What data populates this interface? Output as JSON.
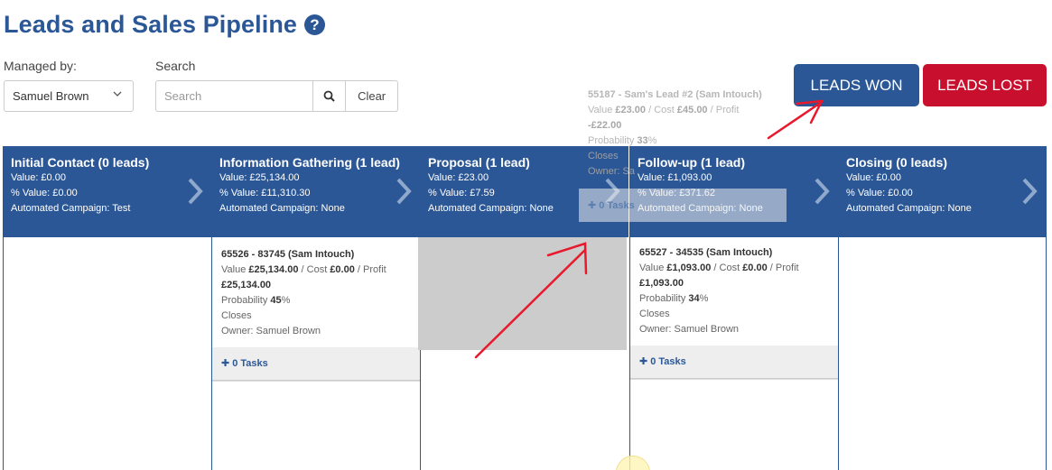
{
  "page": {
    "title": "Leads and Sales Pipeline",
    "help_icon": "question-circle-icon"
  },
  "filters": {
    "managed_label": "Managed by:",
    "managed_value": "Samuel Brown",
    "search_label": "Search",
    "search_placeholder": "Search",
    "clear_label": "Clear"
  },
  "actions": {
    "won_label": "LEADS WON",
    "lost_label": "LEADS LOST",
    "won_color": "#2b5797",
    "lost_color": "#c8102e"
  },
  "columns": [
    {
      "title": "Initial Contact (0 leads)",
      "value": "Value: £0.00",
      "pct_value": "% Value: £0.00",
      "campaign": "Automated Campaign: Test"
    },
    {
      "title": "Information Gathering (1 lead)",
      "value": "Value: £25,134.00",
      "pct_value": "% Value: £11,310.30",
      "campaign": "Automated Campaign: None"
    },
    {
      "title": "Proposal (1 lead)",
      "value": "Value: £23.00",
      "pct_value": "% Value: £7.59",
      "campaign": "Automated Campaign: None"
    },
    {
      "title": "Follow-up (1 lead)",
      "value": "Value: £1,093.00",
      "pct_value": "% Value: £371.62",
      "campaign": "Automated Campaign: None"
    },
    {
      "title": "Closing (0 leads)",
      "value": "Value: £0.00",
      "pct_value": "% Value: £0.00",
      "campaign": "Automated Campaign: None"
    }
  ],
  "cards": [
    {
      "title": "65526 - 83745 (Sam Intouch)",
      "value_lbl": "Value",
      "value": "£25,134.00",
      "cost_lbl": "/ Cost",
      "cost": "£0.00",
      "profit_lbl": "/ Profit",
      "profit": "£25,134.00",
      "prob_lbl": "Probability",
      "prob": "45",
      "pct": "%",
      "closes": "Closes",
      "owner": "Owner: Samuel Brown",
      "tasks": "0 Tasks"
    },
    {
      "title": "65527 - 34535 (Sam Intouch)",
      "value_lbl": "Value",
      "value": "£1,093.00",
      "cost_lbl": "/ Cost",
      "cost": "£0.00",
      "profit_lbl": "/ Profit",
      "profit": "£1,093.00",
      "prob_lbl": "Probability",
      "prob": "34",
      "pct": "%",
      "closes": "Closes",
      "owner": "Owner: Samuel Brown",
      "tasks": "0 Tasks"
    }
  ],
  "dragging": {
    "title": "55187 - Sam's Lead #2 (Sam Intouch)",
    "value_lbl": "Value",
    "value": "£23.00",
    "cost_lbl": "/ Cost",
    "cost": "£45.00",
    "profit_lbl": "/ Profit",
    "profit": "-£22.00",
    "prob_lbl": "Probability",
    "prob": "33",
    "pct": "%",
    "closes": "Closes",
    "owner": "Owner: Sa",
    "tasks": "0 Tasks"
  },
  "annotation_color": "#e8192c"
}
